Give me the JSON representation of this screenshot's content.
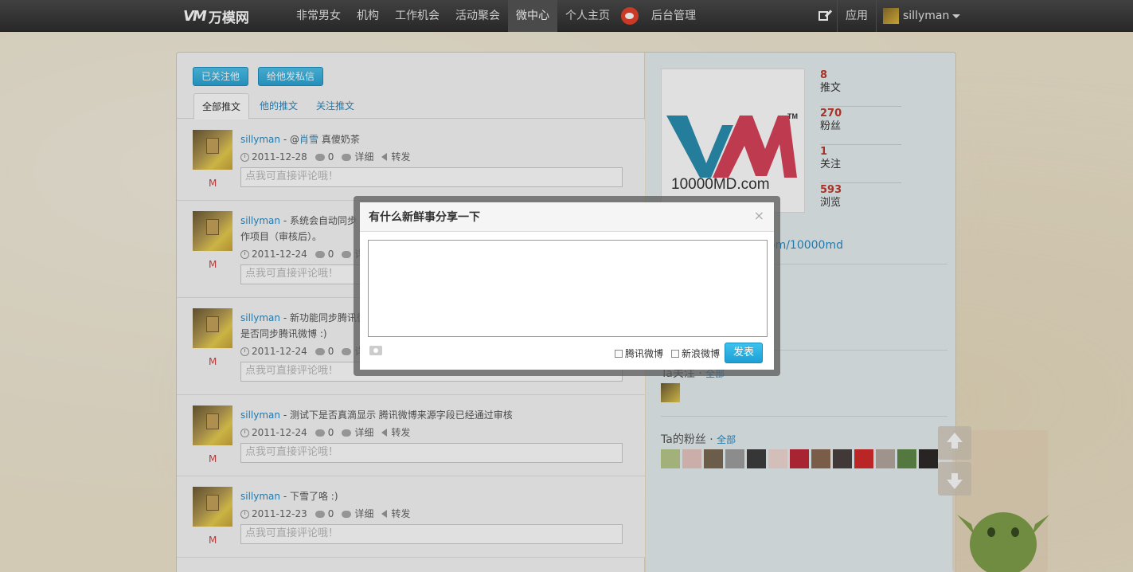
{
  "nav": {
    "logo_text": "万模网",
    "items": [
      "非常男女",
      "机构",
      "工作机会",
      "活动聚会",
      "微中心",
      "个人主页"
    ],
    "admin": "后台管理",
    "apps": "应用",
    "username": "sillyman"
  },
  "profile_actions": {
    "follow": "已关注他",
    "message": "给他发私信"
  },
  "tabs": [
    "全部推文",
    "他的推文",
    "关注推文"
  ],
  "feed": [
    {
      "user": "sillyman",
      "text": " - @",
      "mention": "肖雪",
      "tail": " 真傻奶茶",
      "line2": "",
      "date": "2011-12-28",
      "comments": "0",
      "detail": "详细",
      "forward": "转发",
      "placeholder": "点我可直接评论哦！",
      "badge": "M"
    },
    {
      "user": "sillyman",
      "text": " - 系统会自动同步 您",
      "mention": "",
      "tail": "",
      "line2": "作项目（审核后）。",
      "date": "2011-12-24",
      "comments": "0",
      "detail": "详",
      "forward": "",
      "placeholder": "点我可直接评论哦！",
      "badge": "M"
    },
    {
      "user": "sillyman",
      "text": " - 新功能同步腾讯微",
      "mention": "",
      "tail": "",
      "line2": "是否同步腾讯微博 :)",
      "date": "2011-12-24",
      "comments": "0",
      "detail": "详",
      "forward": "",
      "placeholder": "点我可直接评论哦！",
      "badge": "M"
    },
    {
      "user": "sillyman",
      "text": " - 测试下是否真滴显示 腾讯微博来源字段已经通过审核",
      "mention": "",
      "tail": "",
      "line2": "",
      "date": "2011-12-24",
      "comments": "0",
      "detail": "详细",
      "forward": "转发",
      "placeholder": "点我可直接评论哦！",
      "badge": "M"
    },
    {
      "user": "sillyman",
      "text": " - 下雪了咯 :)",
      "mention": "",
      "tail": "",
      "line2": "",
      "date": "2011-12-23",
      "comments": "0",
      "detail": "详细",
      "forward": "转发",
      "placeholder": "点我可直接评论哦！",
      "badge": "M"
    }
  ],
  "stats": [
    {
      "num": "8",
      "label": "推文"
    },
    {
      "num": "270",
      "label": "粉丝"
    },
    {
      "num": "1",
      "label": "关注"
    },
    {
      "num": "593",
      "label": "浏览"
    }
  ],
  "profile_logo_text": "10000MD.com",
  "profile_url": "om/10000md",
  "following": {
    "title": "Ta关注 · ",
    "all": "全部"
  },
  "fans": {
    "title": "Ta的粉丝 · ",
    "all": "全部"
  },
  "fan_colors": [
    "#b9c98a",
    "#e8c7c2",
    "#7a6a55",
    "#a0a0a0",
    "#3e3e3e",
    "#f2d9d3",
    "#c02a3a",
    "#8a6a52",
    "#4a4040",
    "#d42b2b",
    "#b5a9a0",
    "#5f8a4a",
    "#2e2a2a"
  ],
  "modal": {
    "title": "有什么新鲜事分享一下",
    "close": "×",
    "tencent": "腾讯微博",
    "sina": "新浪微博",
    "publish": "发表"
  }
}
